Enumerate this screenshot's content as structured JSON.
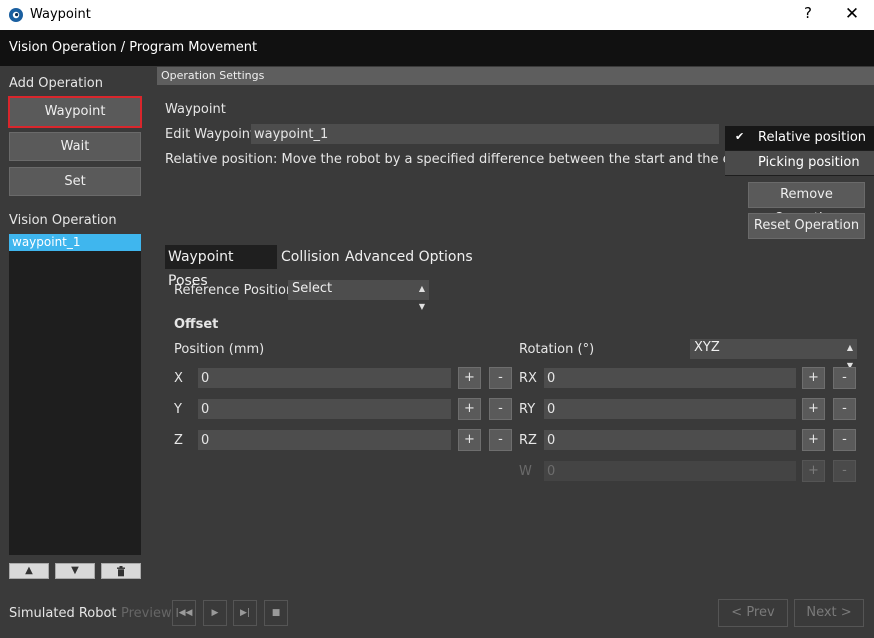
{
  "window": {
    "title": "Waypoint",
    "help_label": "?",
    "close_label": "✕",
    "app_icon": "eye-icon"
  },
  "header": {
    "breadcrumb": "Vision Operation / Program Movement"
  },
  "left": {
    "add_operation_label": "Add Operation",
    "buttons": {
      "waypoint": "Waypoint",
      "wait": "Wait",
      "set": "Set"
    },
    "vision_operation_label": "Vision Operation",
    "operations": [
      "waypoint_1"
    ],
    "list_controls": {
      "up": "▲",
      "down": "▼",
      "delete": "trash-icon"
    }
  },
  "settings": {
    "section_title": "Operation Settings",
    "type_label": "Waypoint",
    "edit_label": "Edit Waypoint",
    "edit_value": "waypoint_1",
    "description": "Relative position: Move the robot by a specified difference between the start and the end position",
    "remove_button": "Remove Operation",
    "reset_button": "Reset Operation"
  },
  "mode_dropdown": {
    "options": [
      {
        "label": "Relative position",
        "checked": true,
        "check_mark": "✔"
      },
      {
        "label": "Picking position",
        "checked": false
      }
    ]
  },
  "tabs": [
    {
      "label": "Waypoint Poses",
      "active": true
    },
    {
      "label": "Collision",
      "active": false
    },
    {
      "label": "Advanced Options",
      "active": false
    }
  ],
  "poses": {
    "reference_label": "Reference Position",
    "reference_value": "Select",
    "offset_title": "Offset",
    "position_label": "Position (mm)",
    "rotation_label": "Rotation (°)",
    "rotation_order": "XYZ",
    "plus": "+",
    "minus": "-",
    "position": [
      {
        "axis": "X",
        "value": "0"
      },
      {
        "axis": "Y",
        "value": "0"
      },
      {
        "axis": "Z",
        "value": "0"
      }
    ],
    "rotation": [
      {
        "axis": "RX",
        "value": "0"
      },
      {
        "axis": "RY",
        "value": "0"
      },
      {
        "axis": "RZ",
        "value": "0"
      },
      {
        "axis": "W",
        "value": "0"
      }
    ]
  },
  "bottom": {
    "simulated_label": "Simulated Robot",
    "preview_label": "Preview",
    "controls": {
      "first": "|◀◀",
      "play": "▶",
      "step": "▶|",
      "stop": "■"
    },
    "prev": "< Prev",
    "next": "Next >"
  },
  "colors": {
    "selected_border": "#d9262c",
    "list_highlight": "#3fb6ee",
    "header_bg": "#111111",
    "panel_bg": "#3a3a3a"
  }
}
